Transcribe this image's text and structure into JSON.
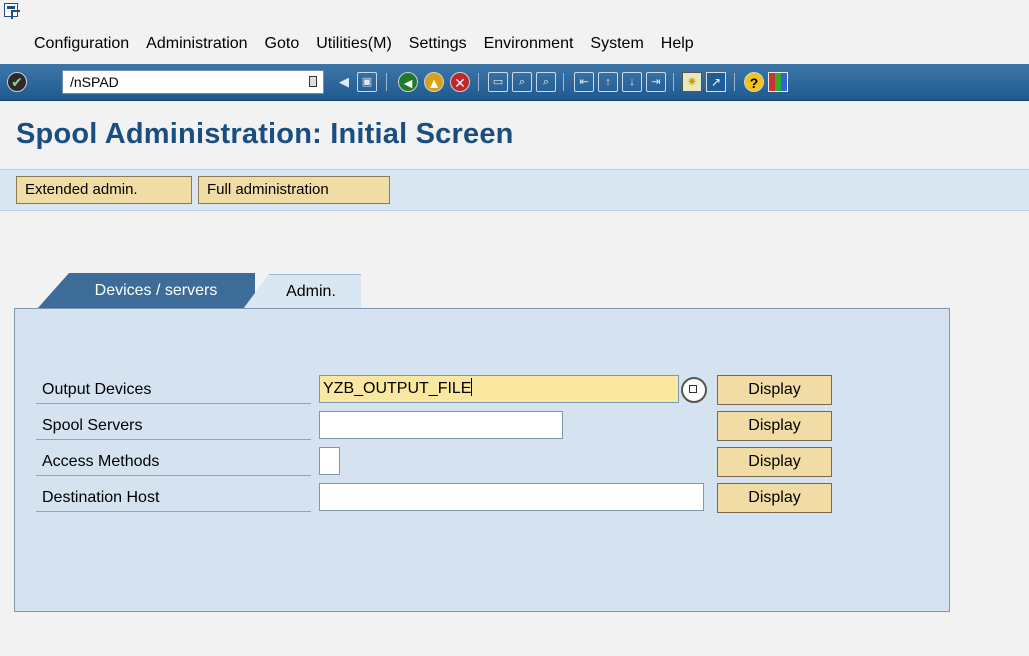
{
  "menubar": {
    "items": [
      "Configuration",
      "Administration",
      "Goto",
      "Utilities(M)",
      "Settings",
      "Environment",
      "System",
      "Help"
    ]
  },
  "toolbar": {
    "command_field": "/nSPAD",
    "icons": [
      "enter-icon",
      "command-history-icon",
      "back-arrow-icon",
      "save-icon",
      "back-icon",
      "exit-icon",
      "cancel-icon",
      "print-icon",
      "find-icon",
      "find-next-icon",
      "first-page-icon",
      "previous-page-icon",
      "next-page-icon",
      "last-page-icon",
      "new-session-icon",
      "create-shortcut-icon",
      "help-icon",
      "customize-layout-icon"
    ]
  },
  "page": {
    "title": "Spool Administration: Initial Screen"
  },
  "app_toolbar": {
    "extended_admin": "Extended admin.",
    "full_admin": "Full administration"
  },
  "tabs": {
    "devices_servers": "Devices / servers",
    "admin": "Admin."
  },
  "form": {
    "rows": [
      {
        "label": "Output Devices",
        "value": "YZB_OUTPUT_FILE",
        "button": "Display"
      },
      {
        "label": "Spool Servers",
        "value": "",
        "button": "Display"
      },
      {
        "label": "Access Methods",
        "value": "",
        "button": "Display"
      },
      {
        "label": "Destination Host",
        "value": "",
        "button": "Display"
      }
    ]
  },
  "colors": {
    "toolbar_blue": "#2a6398",
    "title_blue": "#1a4e7f",
    "button_tan": "#f2dca6",
    "focus_yellow": "#fbe8a0",
    "panel_blue": "#d5e3f0"
  }
}
